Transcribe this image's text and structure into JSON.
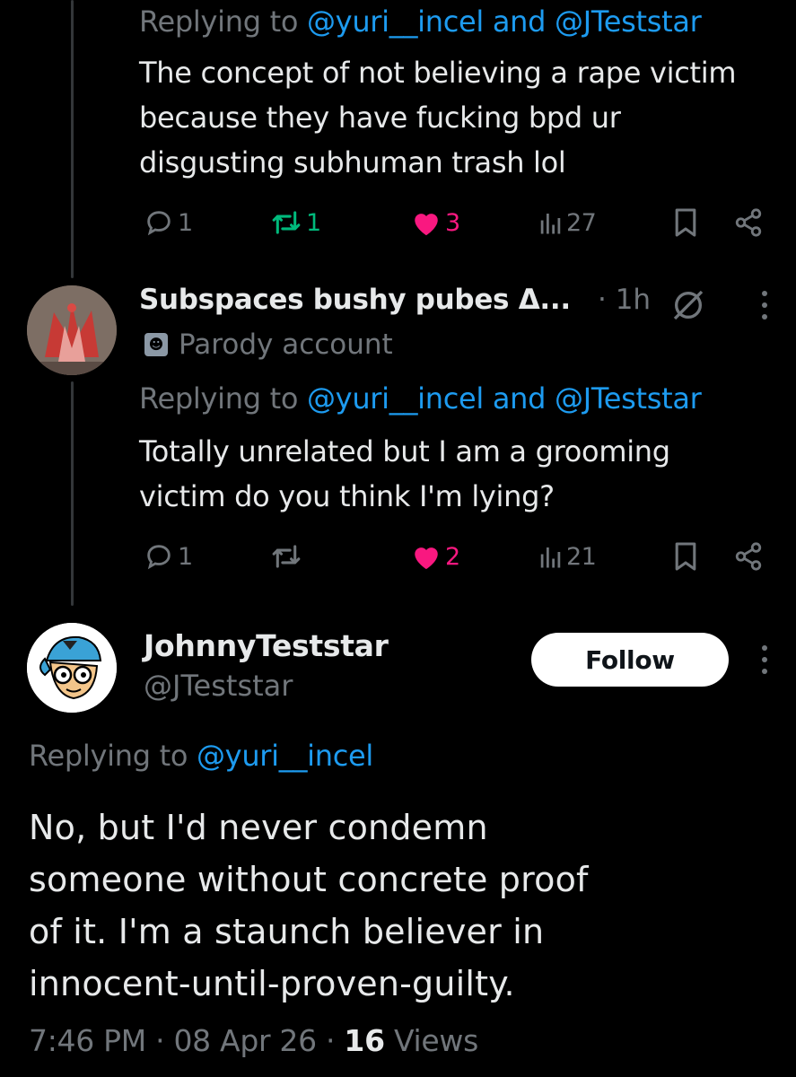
{
  "tweets": [
    {
      "replying_prefix": "Replying to ",
      "replying_users": "@yuri__incel and @JTeststar",
      "text_lines": [
        "The concept of not believing a rape victim",
        "because they have fucking bpd ur",
        "disgusting subhuman trash lol"
      ],
      "replies": "1",
      "reposts": "1",
      "likes": "3",
      "views": "27"
    },
    {
      "display_name": "Subspaces bushy pubes Δ...",
      "time": "· 1h",
      "badge": "Parody account",
      "replying_prefix": "Replying to ",
      "replying_users": "@yuri__incel and @JTeststar",
      "text_lines": [
        "Totally unrelated but I am a grooming",
        "victim do you think I'm lying?"
      ],
      "replies": "1",
      "reposts": "",
      "likes": "2",
      "views": "21"
    }
  ],
  "main": {
    "display_name": "JohnnyTeststar",
    "handle": "@JTeststar",
    "follow_label": "Follow",
    "replying_prefix": "Replying to ",
    "replying_users": "@yuri__incel",
    "text_lines": [
      "No, but I'd never condemn",
      "someone without concrete proof",
      "of it. I'm a staunch believer in",
      "innocent-until-proven-guilty."
    ],
    "time": "7:46 PM",
    "date": "08 Apr 26",
    "views_count": "16",
    "views_label": "Views"
  },
  "colors": {
    "background": "#000000",
    "text": "#e7e9ea",
    "muted": "#71767b",
    "link": "#1d9bf0",
    "like": "#f91880",
    "repost": "#00ba7c"
  }
}
